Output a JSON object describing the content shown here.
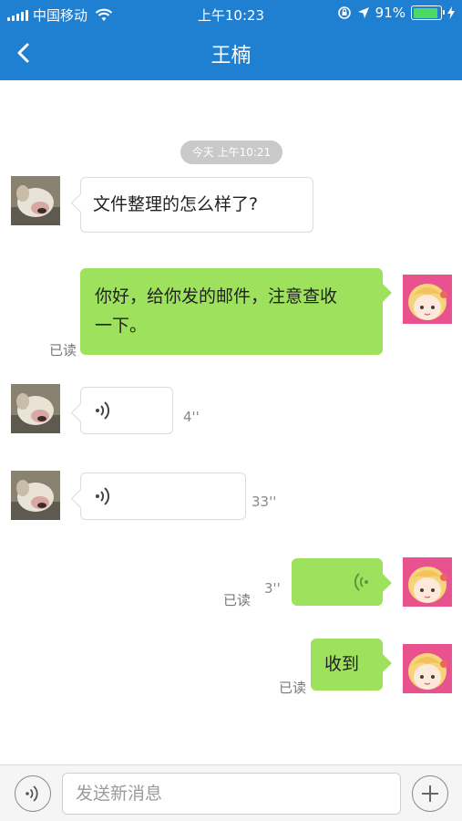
{
  "status_bar": {
    "carrier": "中国移动",
    "time": "上午10:23",
    "battery_percent": "91%",
    "battery_level": 0.91
  },
  "nav": {
    "title": "王楠",
    "back_icon": "chevron-left-icon"
  },
  "chat": {
    "timestamp": "今天 上午10:21",
    "messages": [
      {
        "side": "in",
        "type": "text",
        "text": "文件整理的怎么样了?"
      },
      {
        "side": "out",
        "type": "text",
        "line1": "你好，给你发的邮件，注意查收",
        "line2": "一下。",
        "status": "已读"
      },
      {
        "side": "in",
        "type": "voice",
        "duration": "4''"
      },
      {
        "side": "in",
        "type": "voice",
        "duration": "33''"
      },
      {
        "side": "out",
        "type": "voice",
        "duration": "3''",
        "status": "已读"
      },
      {
        "side": "out",
        "type": "text",
        "text": "收到",
        "status": "已读"
      }
    ]
  },
  "input_bar": {
    "voice_icon": "voice-icon",
    "placeholder": "发送新消息",
    "plus_icon": "plus-icon"
  },
  "colors": {
    "header": "#1f7fd1",
    "outgoing_bubble": "#9ee15d",
    "incoming_bubble": "#ffffff",
    "timestamp_pill": "#c9c9c9"
  }
}
